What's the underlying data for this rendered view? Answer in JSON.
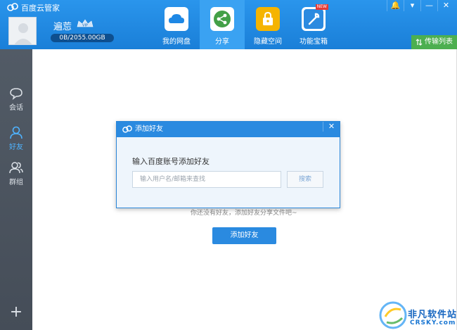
{
  "app": {
    "title": "百度云管家"
  },
  "window_controls": [
    "🔔",
    "▾",
    "—",
    "✕"
  ],
  "user": {
    "name": "遍莣",
    "vip": "VIP",
    "quota": "0B/2055.00GB"
  },
  "nav": [
    {
      "label": "我的网盘",
      "icon": "cloud-drive-icon"
    },
    {
      "label": "分享",
      "icon": "share-icon"
    },
    {
      "label": "隐藏空间",
      "icon": "lock-icon"
    },
    {
      "label": "功能宝箱",
      "icon": "toolbox-icon",
      "badge": "NEW"
    }
  ],
  "transfer": {
    "label": "传输列表"
  },
  "sidebar": [
    {
      "label": "会话"
    },
    {
      "label": "好友"
    },
    {
      "label": "群组"
    }
  ],
  "sidebar_add": "+",
  "main": {
    "empty_text": "你还没有好友，添加好友分享文件吧~",
    "add_friend_button": "添加好友"
  },
  "dialog": {
    "title": "添加好友",
    "close": "✕",
    "prompt": "输入百度账号添加好友",
    "input_placeholder": "输入用户名/邮箱来查找",
    "input_value": "",
    "search_button": "搜索"
  },
  "watermark": {
    "title": "非凡软件站",
    "subtitle": "CRSKY.com"
  },
  "colors": {
    "header": "#1e88e5",
    "sidebar": "#4b5563",
    "accent": "#2a8ae0",
    "transfer": "#4caf50"
  }
}
